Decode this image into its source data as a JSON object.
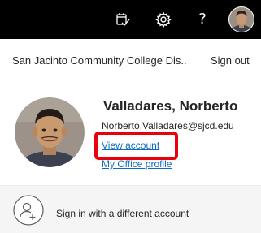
{
  "topbar": {
    "background": "#000000",
    "icons": {
      "todo": "todo-check-icon",
      "settings": "gear-icon",
      "help": "?",
      "avatar": "avatar"
    }
  },
  "account_panel": {
    "org_name": "San Jacinto Community College Dis...",
    "sign_out": "Sign out",
    "user_name": "Valladares, Norberto",
    "email": "Norberto.Valladares@sjcd.edu",
    "view_account": "View account",
    "my_office_profile": "My Office profile",
    "switch_account": "Sign in with a different account",
    "highlight_color": "#e8000b",
    "link_color": "#0f6cbd"
  }
}
